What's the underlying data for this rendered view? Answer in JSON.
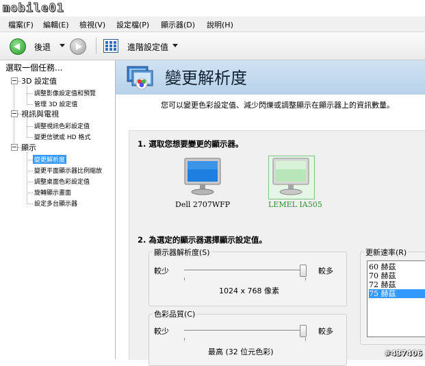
{
  "watermark": {
    "top": "mobile01",
    "bottom": "#437406"
  },
  "menu": [
    {
      "label": "檔案(F)"
    },
    {
      "label": "編輯(E)"
    },
    {
      "label": "檢視(V)"
    },
    {
      "label": "設定檔(P)"
    },
    {
      "label": "顯示器(D)"
    },
    {
      "label": "說明(H)"
    }
  ],
  "toolbar": {
    "back_label": "後退",
    "advanced_label": "進階設定值"
  },
  "sidebar": {
    "header": "選取一個任務...",
    "categories": [
      {
        "label": "3D 設定值",
        "items": [
          "調整影像設定值和預覽",
          "管理 3D 設定值"
        ]
      },
      {
        "label": "視訊與電視",
        "items": [
          "調整視訊色彩設定值",
          "變更信號或 HD 格式"
        ]
      },
      {
        "label": "顯示",
        "items": [
          "變更解析度",
          "變更平面顯示器比例縮放",
          "調整桌面色彩設定值",
          "旋轉顯示畫面",
          "設定多台顯示器"
        ]
      }
    ],
    "selected": "變更解析度"
  },
  "page": {
    "title": "變更解析度",
    "description": "您可以變更色彩設定值、減少閃爍或調整顯示在顯示器上的資訊數量。"
  },
  "step1": {
    "title": "1. 選取您想要變更的顯示器。",
    "monitors": [
      {
        "label": "Dell 2707WFP",
        "selected": false
      },
      {
        "label": "LEMEL IA505",
        "selected": true
      }
    ]
  },
  "step2": {
    "title": "2. 為選定的顯示器選擇顯示設定值。",
    "resolution": {
      "group": "顯示器解析度(S)",
      "less": "較少",
      "more": "較多",
      "value": "1024 x 768 像素",
      "level": 0.98
    },
    "color": {
      "group": "色彩品質(C)",
      "less": "較少",
      "more": "較多",
      "value": "最高 (32 位元色彩)",
      "level": 0.98
    },
    "refresh": {
      "group": "更新速率(R)",
      "options": [
        "60 赫茲",
        "70 赫茲",
        "72 赫茲",
        "75 赫茲"
      ],
      "selected": "75 赫茲"
    }
  },
  "colors": {
    "selection": "#3399ff",
    "header_band": "#c4dbef",
    "selected_monitor_text": "#2e8b2e"
  }
}
